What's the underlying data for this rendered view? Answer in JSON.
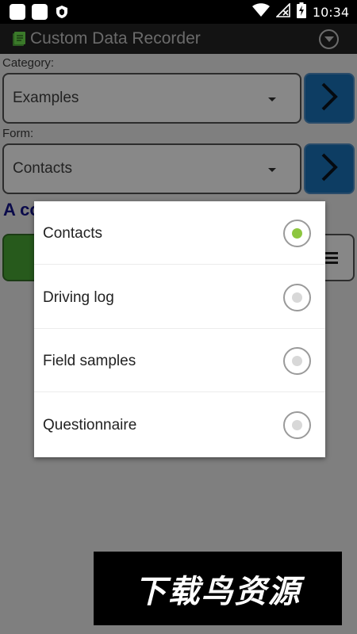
{
  "status_bar": {
    "time": "10:34",
    "icons": [
      "app-icon",
      "app-icon",
      "shield-icon",
      "wifi-icon",
      "no-signal-icon",
      "battery-charging-icon"
    ]
  },
  "app": {
    "title": "Custom Data Recorder",
    "accent_color": "#8dc63f"
  },
  "main": {
    "category_label": "Category:",
    "category_value": "Examples",
    "form_label": "Form:",
    "form_value": "Contacts",
    "description_partial": "A co"
  },
  "dialog": {
    "options": [
      {
        "label": "Contacts",
        "selected": true
      },
      {
        "label": "Driving log",
        "selected": false
      },
      {
        "label": "Field samples",
        "selected": false
      },
      {
        "label": "Questionnaire",
        "selected": false
      }
    ]
  },
  "watermark": {
    "text": "下载鸟资源"
  }
}
